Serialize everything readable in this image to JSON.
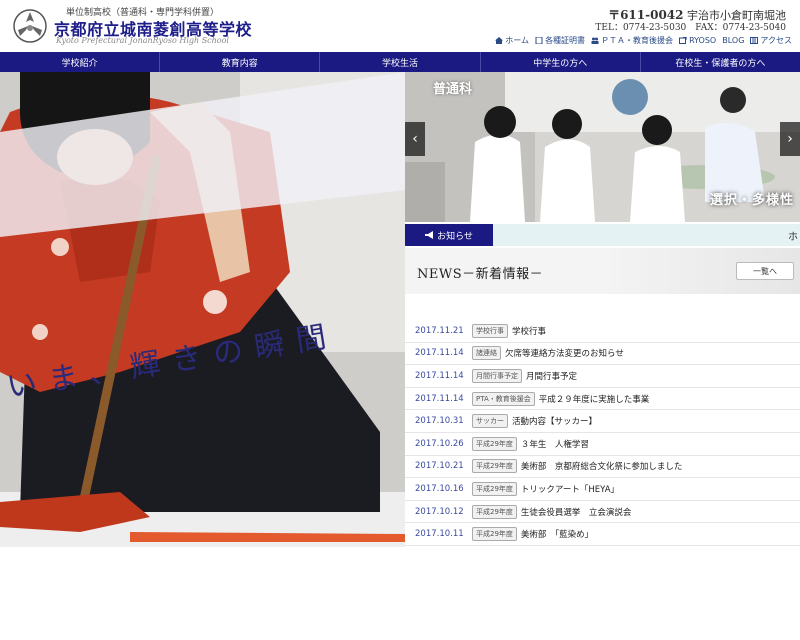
{
  "header": {
    "school_sub": "単位制高校（普通科・専門学科併置）",
    "school_name": "京都府立城南菱創高等学校",
    "school_en": "Kyoto Prefectural JonanRyoso High School",
    "postal": "〒611-0042",
    "address": "宇治市小倉町南堀池",
    "tel": "TEL：0774-23-5030　FAX：0774-23-5040",
    "util_links": [
      {
        "label": "ホーム",
        "icon": "home-icon"
      },
      {
        "label": "各種証明書",
        "icon": "document-icon"
      },
      {
        "label": "ＰＴＡ・教育後援会",
        "icon": "people-icon"
      },
      {
        "label": "RYOSO",
        "icon": "external-link-icon"
      },
      {
        "label": "BLOG",
        "icon": ""
      },
      {
        "label": "アクセス",
        "icon": "map-icon"
      }
    ]
  },
  "nav": [
    {
      "label": "学校紹介"
    },
    {
      "label": "教育内容"
    },
    {
      "label": "学校生活"
    },
    {
      "label": "中学生の方へ"
    },
    {
      "label": "在校生・保護者の方へ"
    }
  ],
  "hero": {
    "catch": "いま、輝きの瞬間"
  },
  "slide": {
    "label": "普通科",
    "caption": "選択・多様性",
    "prev": "‹",
    "next": "›"
  },
  "notice": {
    "tab_label": "お知らせ",
    "ticker": "ホ"
  },
  "news": {
    "title": "NEWS－新着情報－",
    "more_label": "一覧へ",
    "items": [
      {
        "date": "2017.11.21",
        "tag": "学校行事",
        "text": "学校行事"
      },
      {
        "date": "2017.11.14",
        "tag": "諸連絡",
        "text": "欠席等連絡方法変更のお知らせ"
      },
      {
        "date": "2017.11.14",
        "tag": "月間行事予定",
        "text": "月間行事予定"
      },
      {
        "date": "2017.11.14",
        "tag": "PTA・教育後援会",
        "text": "平成２９年度に実施した事業"
      },
      {
        "date": "2017.10.31",
        "tag": "サッカー",
        "text": "活動内容【サッカー】"
      },
      {
        "date": "2017.10.26",
        "tag": "平成29年度",
        "text": "３年生　人権学習"
      },
      {
        "date": "2017.10.21",
        "tag": "平成29年度",
        "text": "美術部　京都府総合文化祭に参加しました"
      },
      {
        "date": "2017.10.16",
        "tag": "平成29年度",
        "text": "トリックアート「HEYA」"
      },
      {
        "date": "2017.10.12",
        "tag": "平成29年度",
        "text": "生徒会役員選挙　立会演説会"
      },
      {
        "date": "2017.10.11",
        "tag": "平成29年度",
        "text": "美術部　「藍染め」"
      }
    ]
  },
  "colors": {
    "brand_navy": "#1a1a82",
    "link_blue": "#3a4aa0",
    "notice_bg": "#e4f2f4"
  }
}
